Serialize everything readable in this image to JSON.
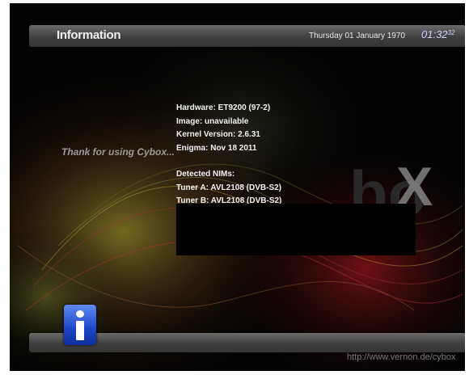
{
  "header": {
    "title": "Information",
    "date": "Thursday 01 January 1970",
    "time_main": "01:32",
    "time_seconds": "32"
  },
  "thanks_text": "Thank for using Cybox...",
  "info_lines": [
    "Hardware: ET9200 (97-2)",
    "Image: unavailable",
    "Kernel Version: 2.6.31",
    "Enigma: Nov 18 2011"
  ],
  "nims_lines": [
    "Detected NIMs:",
    "Tuner A: AVL2108 (DVB-S2)",
    "Tuner B: AVL2108 (DVB-S2)"
  ],
  "watermark_url": "http://www.vernon.de/cybox",
  "info_button": {
    "icon": "info-icon",
    "color": "#1b45c8"
  }
}
